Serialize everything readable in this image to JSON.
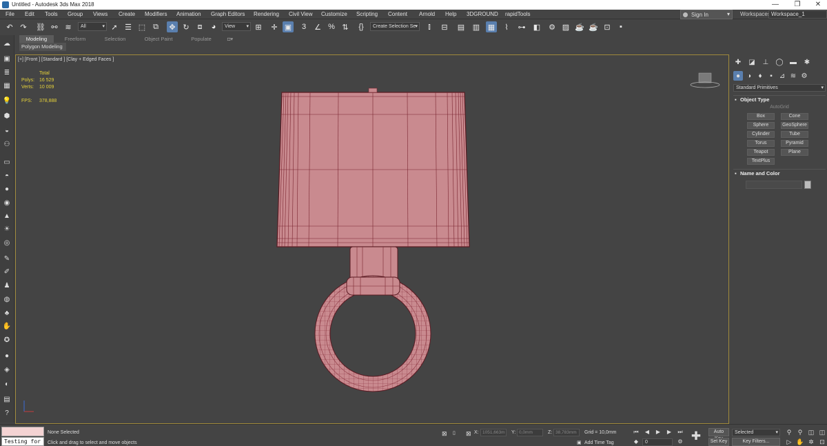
{
  "window": {
    "title": "Untitled - Autodesk 3ds Max 2018",
    "minimize": "—",
    "restore": "❐",
    "close": "✕"
  },
  "menu": [
    "File",
    "Edit",
    "Tools",
    "Group",
    "Views",
    "Create",
    "Modifiers",
    "Animation",
    "Graph Editors",
    "Rendering",
    "Civil View",
    "Customize",
    "Scripting",
    "Content",
    "Arnold",
    "Help",
    "3DGROUND",
    "rapidTools"
  ],
  "account": {
    "sign_in": "Sign In"
  },
  "workspaces": {
    "label": "Workspaces:",
    "value": "Workspace_1"
  },
  "toolbar": {
    "selection_filter": "All",
    "ref_coord": "View",
    "named_selection": "Create Selection Se"
  },
  "ribbon": {
    "tabs": [
      "Modeling",
      "Freeform",
      "Selection",
      "Object Paint",
      "Populate"
    ],
    "active_tab": "Modeling",
    "panel": "Polygon Modeling"
  },
  "viewport": {
    "label": "[+] [Front ] [Standard ] [Clay + Edged Faces ]",
    "stats": {
      "header": "Total",
      "polys_label": "Polys:",
      "polys": "16 529",
      "verts_label": "Verts:",
      "verts": "10 009",
      "fps_label": "FPS:",
      "fps": "378,888"
    },
    "wire_color": "#a84650",
    "mesh_color": "#c98a8f",
    "border_color": "#a08a3c"
  },
  "command_panel": {
    "category": "Standard Primitives",
    "object_type_title": "Object Type",
    "autogrid": "AutoGrid",
    "buttons": [
      "Box",
      "Cone",
      "Sphere",
      "GeoSphere",
      "Cylinder",
      "Tube",
      "Torus",
      "Pyramid",
      "Teapot",
      "Plane",
      "TextPlus"
    ],
    "name_color_title": "Name and Color"
  },
  "status": {
    "script_input": "Testing for :",
    "selection": "None Selected",
    "prompt": "Click and drag to select and move objects",
    "x_label": "X:",
    "x_value": "1051,663m",
    "y_label": "Y:",
    "y_value": "0,0mm",
    "z_label": "Z:",
    "z_value": "38,783mm",
    "grid": "Grid = 10,0mm",
    "add_time_tag": "Add Time Tag",
    "frame": "0",
    "auto_key": "Auto Key",
    "set_key": "Set Key",
    "key_mode": "Selected",
    "key_filters": "Key Filters..."
  }
}
